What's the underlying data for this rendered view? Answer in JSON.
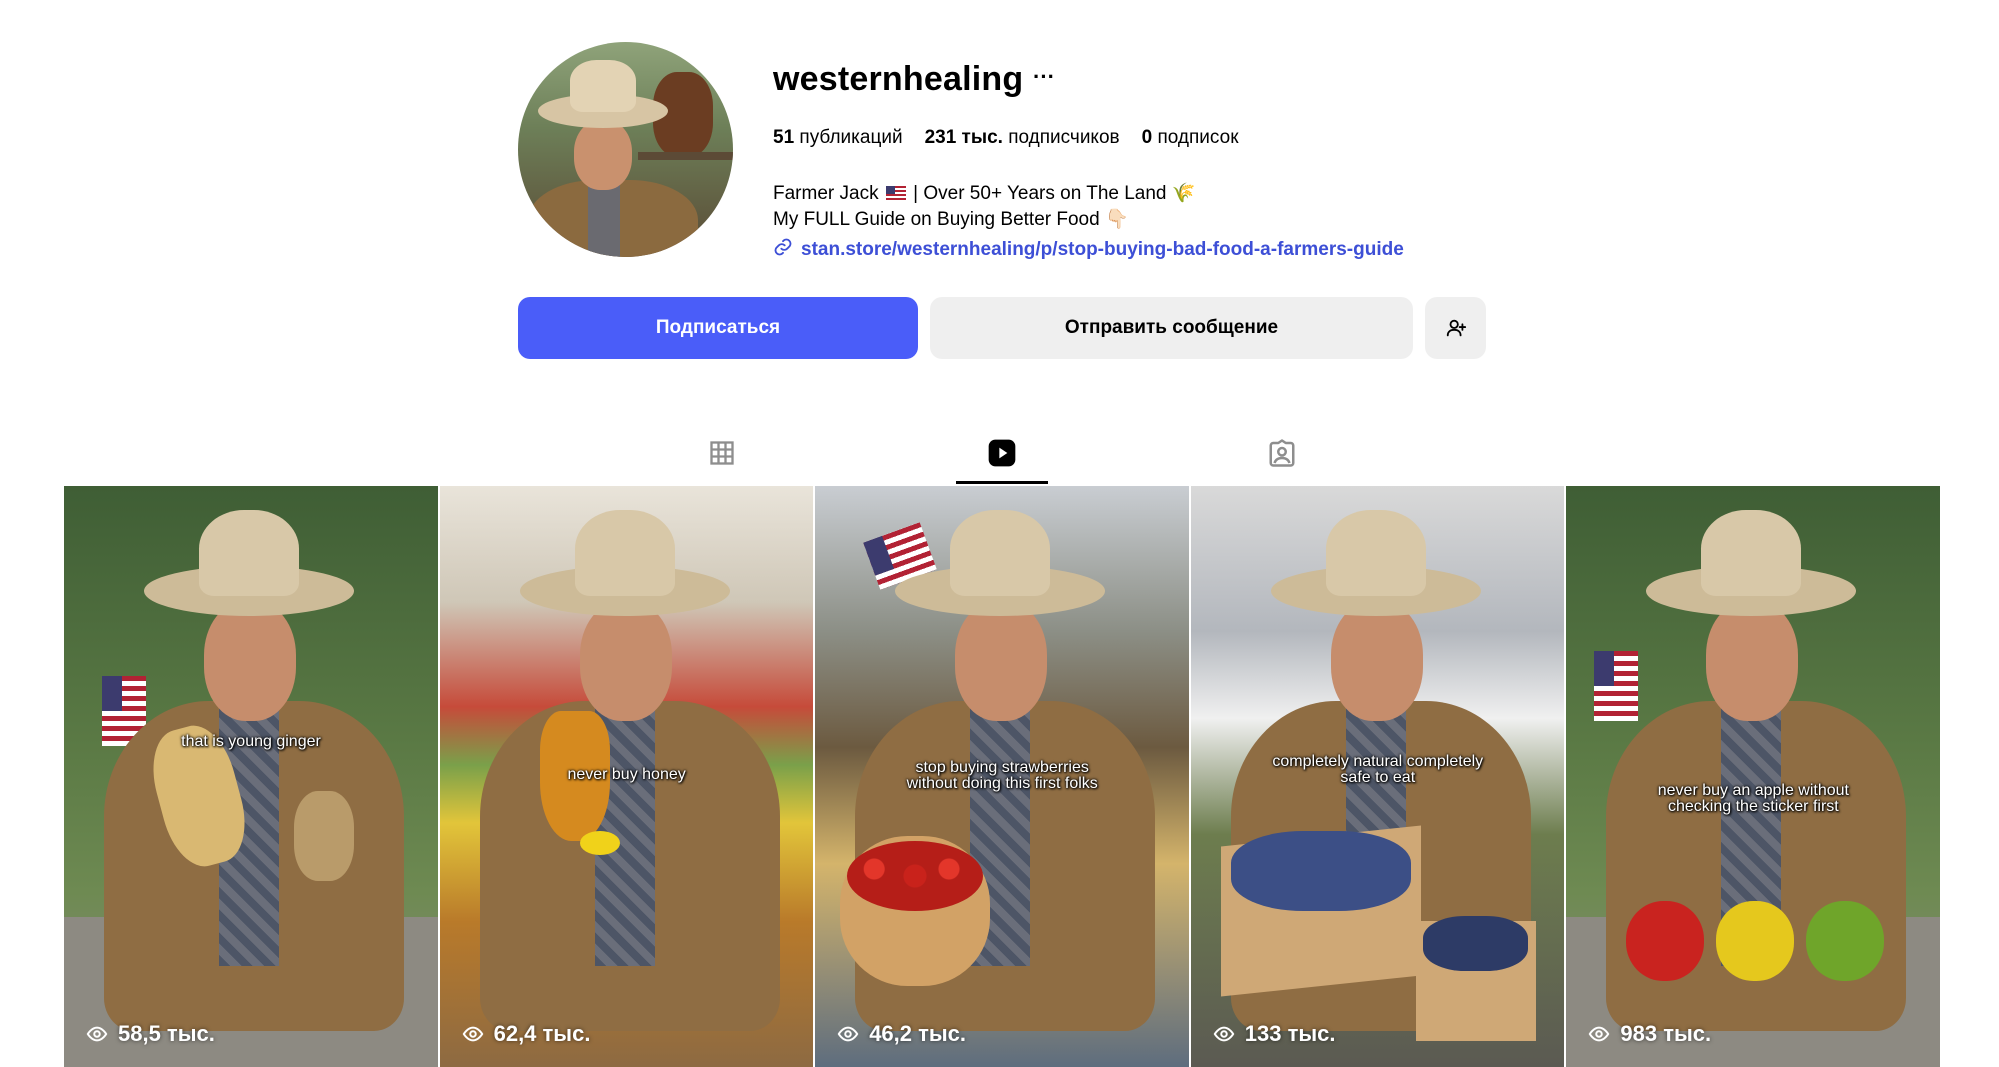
{
  "profile": {
    "username": "westernhealing",
    "more_label": "···",
    "stats": {
      "posts_count": "51",
      "posts_label": "публикаций",
      "followers_count": "231 тыс.",
      "followers_label": "подписчиков",
      "following_count": "0",
      "following_label": "подписок"
    },
    "bio_line1_a": "Farmer Jack",
    "bio_line1_b": "| Over 50+ Years on The Land 🌾",
    "bio_line2": "My FULL Guide on Buying Better Food 👇🏻",
    "link": "stan.store/westernhealing/p/stop-buying-bad-food-a-farmers-guide"
  },
  "buttons": {
    "follow": "Подписаться",
    "message": "Отправить сообщение"
  },
  "tabs": [
    {
      "name": "grid",
      "icon": "grid-icon",
      "active": false
    },
    {
      "name": "reels",
      "icon": "reels-icon",
      "active": true
    },
    {
      "name": "tagged",
      "icon": "tagged-icon",
      "active": false
    }
  ],
  "reels": [
    {
      "caption": "that is young ginger",
      "views": "58,5 тыс."
    },
    {
      "caption": "never buy honey",
      "views": "62,4 тыс."
    },
    {
      "caption_line1": "stop buying strawberries",
      "caption_line2": "without doing this first folks",
      "views": "46,2 тыс."
    },
    {
      "caption_line1": "completely natural completely",
      "caption_line2": "safe to eat",
      "views": "133 тыс."
    },
    {
      "caption_line1": "never buy an apple without",
      "caption_line2": "checking the sticker first",
      "views": "983 тыс."
    }
  ],
  "colors": {
    "follow_button": "#4a5df9",
    "secondary_button": "#efefef",
    "link": "#3d4fd6"
  }
}
